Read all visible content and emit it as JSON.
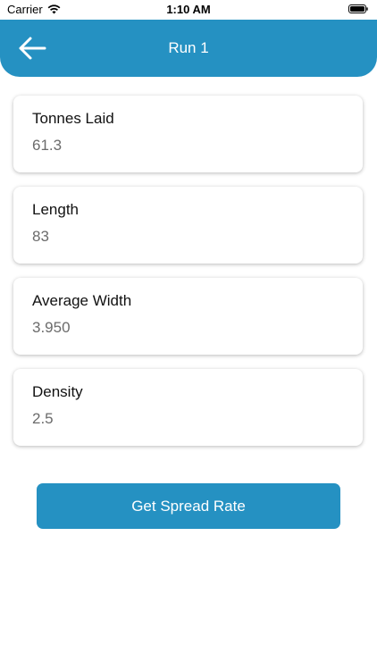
{
  "status_bar": {
    "carrier": "Carrier",
    "time": "1:10 AM"
  },
  "header": {
    "title": "Run 1",
    "back_icon": "arrow-left-icon",
    "background_color": "#2591c2"
  },
  "fields": [
    {
      "label": "Tonnes Laid",
      "value": "61.3"
    },
    {
      "label": "Length",
      "value": "83"
    },
    {
      "label": "Average Width",
      "value": "3.950"
    },
    {
      "label": "Density",
      "value": "2.5"
    }
  ],
  "action": {
    "label": "Get Spread Rate",
    "color": "#2591c2"
  }
}
